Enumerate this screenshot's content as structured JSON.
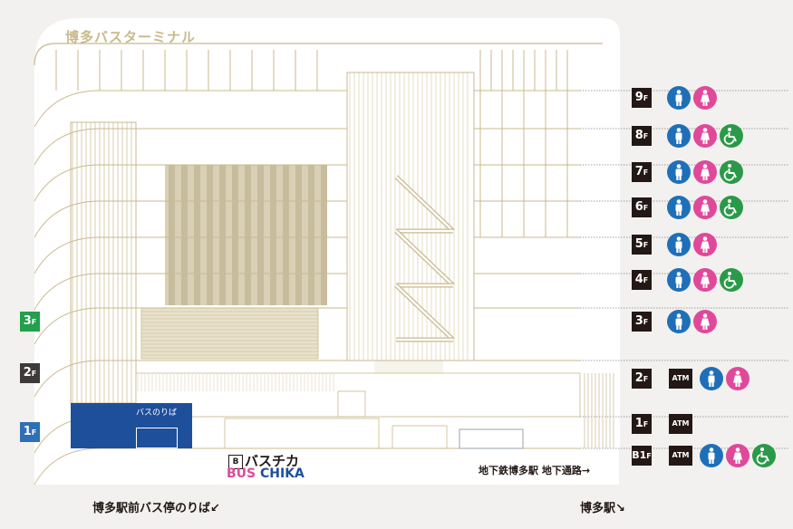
{
  "building_name": "博多バスターミナル",
  "bus_stop_sign": "バスのりば",
  "mall_logo_jp": "バスチカ",
  "mall_logo_en_bus": "BUS",
  "mall_logo_en_chika": "CHIKA",
  "subway_link_label": "地下鉄博多駅 地下通路→",
  "bottom_left_label": "博多駅前バス停のりば↙",
  "bottom_right_label": "博多駅↘",
  "left_floor_markers": [
    {
      "num": "3",
      "unit": "F",
      "color": "#22a04b"
    },
    {
      "num": "2",
      "unit": "F",
      "color": "#3e3a39"
    },
    {
      "num": "1",
      "unit": "F",
      "color": "#2f6fb7"
    }
  ],
  "floor_guide": [
    {
      "num": "9",
      "unit": "F",
      "facilities": [
        "male-restroom",
        "female-restroom"
      ]
    },
    {
      "num": "8",
      "unit": "F",
      "facilities": [
        "male-restroom",
        "female-restroom",
        "accessible-restroom"
      ]
    },
    {
      "num": "7",
      "unit": "F",
      "facilities": [
        "male-restroom",
        "female-restroom",
        "accessible-restroom"
      ]
    },
    {
      "num": "6",
      "unit": "F",
      "facilities": [
        "male-restroom",
        "female-restroom",
        "accessible-restroom"
      ]
    },
    {
      "num": "5",
      "unit": "F",
      "facilities": [
        "male-restroom",
        "female-restroom"
      ]
    },
    {
      "num": "4",
      "unit": "F",
      "facilities": [
        "male-restroom",
        "female-restroom",
        "accessible-restroom"
      ]
    },
    {
      "num": "3",
      "unit": "F",
      "facilities": [
        "male-restroom",
        "female-restroom"
      ]
    },
    {
      "num": "2",
      "unit": "F",
      "facilities": [
        "atm",
        "male-restroom",
        "female-restroom"
      ]
    },
    {
      "num": "1",
      "unit": "F",
      "facilities": [
        "atm"
      ]
    },
    {
      "num": "B1",
      "unit": "F",
      "facilities": [
        "atm",
        "male-restroom",
        "female-restroom",
        "accessible-restroom"
      ]
    }
  ],
  "atm_label": "ATM",
  "colors": {
    "line": "#c9b98d",
    "panel": "#d9d0b6",
    "male": "#1f6fb8",
    "female": "#e0499a",
    "accessible": "#2a9a48",
    "dark": "#231815",
    "bus_blue": "#1e4f9b"
  }
}
